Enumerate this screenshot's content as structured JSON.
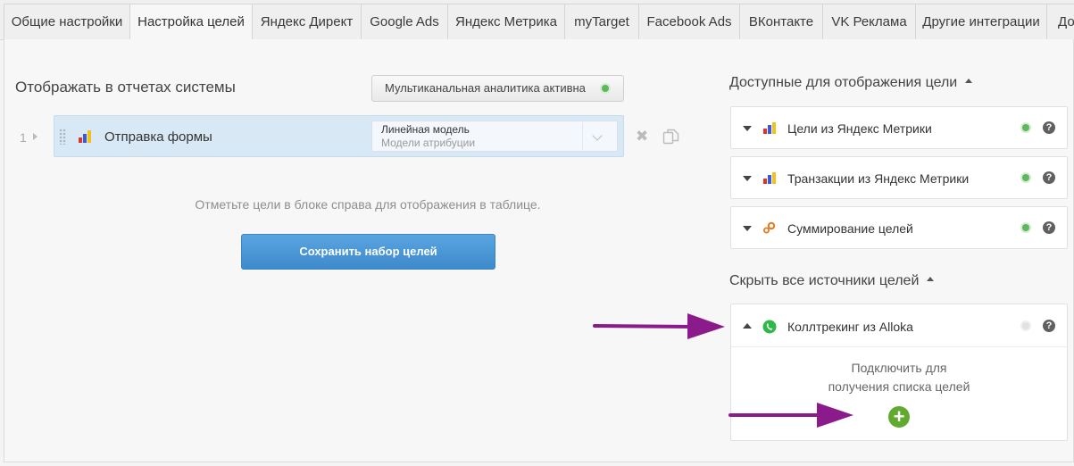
{
  "tabs": [
    {
      "label": "Общие настройки",
      "active": false
    },
    {
      "label": "Настройка целей",
      "active": true
    },
    {
      "label": "Яндекс Директ",
      "active": false
    },
    {
      "label": "Google Ads",
      "active": false
    },
    {
      "label": "Яндекс Метрика",
      "active": false
    },
    {
      "label": "myTarget",
      "active": false
    },
    {
      "label": "Facebook Ads",
      "active": false
    },
    {
      "label": "ВКонтакте",
      "active": false
    },
    {
      "label": "VK Реклама",
      "active": false
    },
    {
      "label": "Другие интеграции",
      "active": false
    },
    {
      "label": "До",
      "active": false
    }
  ],
  "left": {
    "title": "Отображать в отчетах системы",
    "multichannel_button": "Мультиканальная аналитика активна",
    "goal_rows": [
      {
        "number": "1",
        "label": "Отправка формы",
        "attribution_model": "Линейная модель",
        "attribution_caption": "Модели атрибуции"
      }
    ],
    "hint": "Отметьте цели в блоке справа для отображения в таблице.",
    "save_button": "Сохранить набор целей"
  },
  "right": {
    "available_title": "Доступные для отображения цели",
    "available_items": [
      {
        "label": "Цели из Яндекс Метрики",
        "icon": "yandex-metrica-icon",
        "status": "active"
      },
      {
        "label": "Транзакции из Яндекс Метрики",
        "icon": "yandex-metrica-icon",
        "status": "active"
      },
      {
        "label": "Суммирование целей",
        "icon": "gears-icon",
        "status": "active"
      }
    ],
    "hidden_title": "Скрыть все источники целей",
    "hidden_items": [
      {
        "label": "Коллтрекинг из Alloka",
        "icon": "whatsapp-phone-icon",
        "status": "inactive",
        "connect_line1": "Подключить для",
        "connect_line2": "получения списка целей"
      }
    ],
    "help_glyph": "?"
  },
  "colors": {
    "accent_blue": "#3d89cb",
    "active_green": "#5cb85c",
    "add_green": "#62a930",
    "annotation_arrow": "#8b1a8b",
    "row_highlight": "#d8e8f4"
  }
}
